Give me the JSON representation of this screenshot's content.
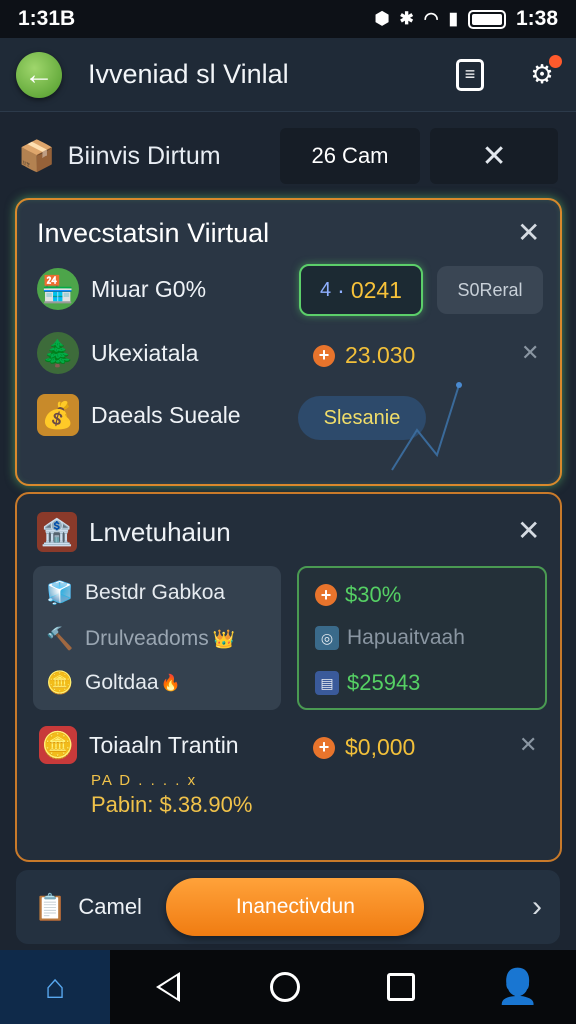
{
  "status_bar": {
    "time_left": "1:31B",
    "time_right": "1:38"
  },
  "header": {
    "title": "Ivveniad sl Vinlal"
  },
  "top_row": {
    "label": "Biinvis Dirtum",
    "value": "26 Cam"
  },
  "card1": {
    "title": "Invecstatsin Viirtual",
    "rows": [
      {
        "label": "Miuar G0%",
        "chip_value": "0241",
        "chip_icon": "4",
        "action": "S0Reral"
      },
      {
        "label": "Ukexiatala",
        "value": "23.030"
      },
      {
        "label": "Daeals Sueale",
        "badge": "Slesanie"
      }
    ]
  },
  "card2": {
    "title": "Lnvetuhaiun",
    "left_items": [
      {
        "label": "Bestdr Gabkoa"
      },
      {
        "label": "Drulveadoms"
      },
      {
        "label": "Goltdaa"
      }
    ],
    "right_items": [
      {
        "value": "$30%"
      },
      {
        "value": "Hapuaitvaah"
      },
      {
        "value": "$25943"
      }
    ],
    "bottom_label": "Toiaaln Trantin",
    "bottom_value": "$0,000",
    "profit_small": "PA D . . . . x",
    "profit": "Pabin: $.38.90%"
  },
  "bottom_bar": {
    "label": "Camel",
    "button": "Inanectivdun"
  },
  "colors": {
    "accent": "#f08a1c",
    "green": "#55d064",
    "gold": "#f2c03a",
    "bg": "#1c2531"
  },
  "icons": [
    "back-arrow-icon",
    "document-icon",
    "gear-icon",
    "close-icon",
    "home-icon",
    "back-triangle-icon",
    "home-circle-icon",
    "recent-square-icon",
    "profile-icon"
  ]
}
